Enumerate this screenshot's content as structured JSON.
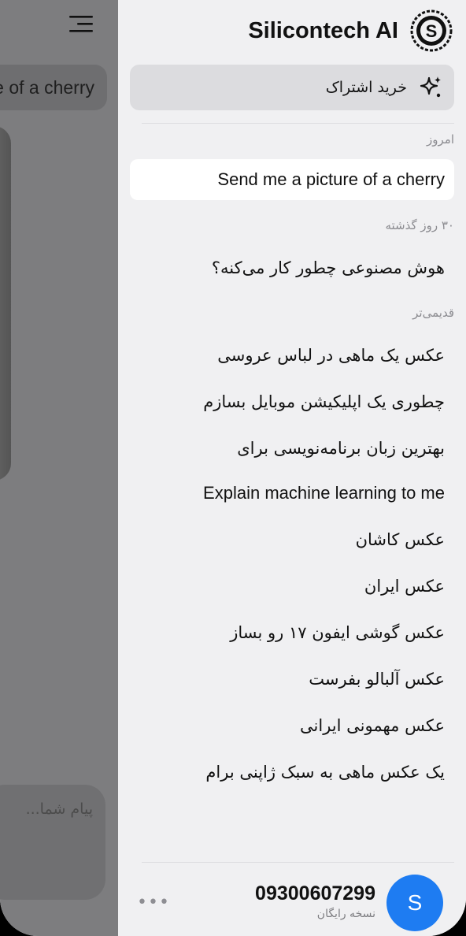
{
  "app": {
    "title": "Silicontech AI"
  },
  "chat": {
    "message_preview": "Send me a picture of a cherry",
    "input_placeholder": "پیام شما..."
  },
  "drawer": {
    "subscribe_label": "خرید اشتراک",
    "sections": {
      "today": "امروز",
      "last_30_days": "۳۰ روز گذشته",
      "older": "قدیمی‌تر"
    },
    "today_items": [
      "Send me a picture of a cherry"
    ],
    "last_30_items": [
      "هوش مصنوعی چطور کار می‌کنه؟"
    ],
    "older_items": [
      "عکس یک ماهی در لباس عروسی",
      "چطوری یک اپلیکیشن موبایل بسازم",
      "بهترین زبان برنامه‌نویسی برای",
      "Explain machine learning to me",
      "عکس کاشان",
      "عکس ایران",
      "عکس گوشی ایفون ۱۷ رو بساز",
      "عکس آلبالو بفرست",
      "عکس مهمونی ایرانی",
      "یک عکس ماهی به سبک ژاپنی برام"
    ]
  },
  "user": {
    "avatar_letter": "S",
    "phone": "09300607299",
    "plan": "نسخه رایگان",
    "more_label": "•••"
  },
  "icons": {
    "menu": "hamburger-menu-icon",
    "logo": "silicontech-logo-icon",
    "sparkle": "sparkle-icon",
    "more": "ellipsis-icon"
  },
  "colors": {
    "accent": "#1e7cf2",
    "drawer_bg": "#f0f0f2",
    "overlay": "#7d7d7f",
    "active_item_bg": "#ffffff"
  }
}
